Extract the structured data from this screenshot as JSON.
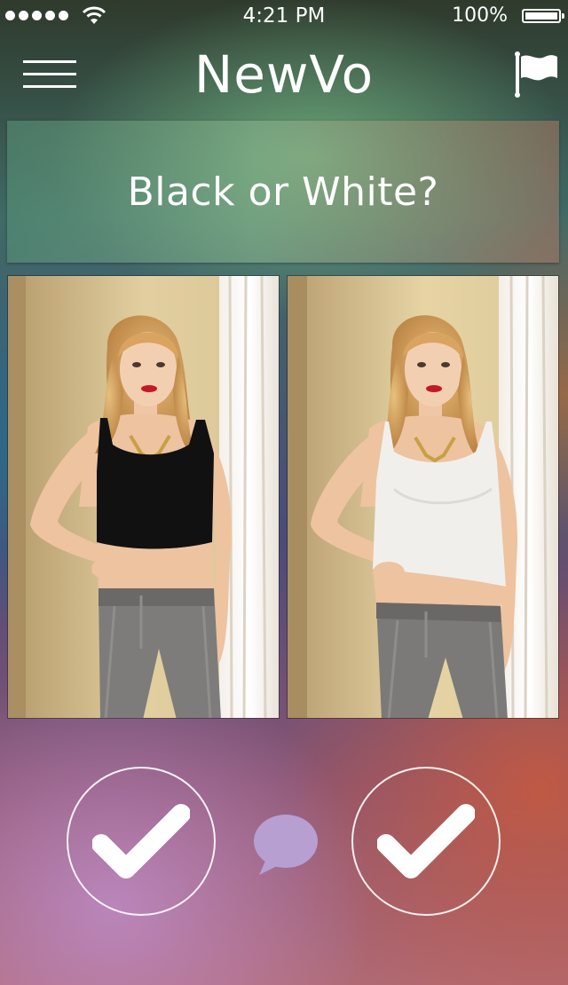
{
  "status_bar": {
    "signal_icon": "signal-dots-icon",
    "wifi_icon": "wifi-icon",
    "time": "4:21 PM",
    "battery_percent": "100%",
    "battery_icon": "battery-icon"
  },
  "navbar": {
    "title": "NewVo",
    "menu_icon": "hamburger-menu-icon",
    "flag_icon": "flag-icon"
  },
  "question": {
    "text": "Black or White?"
  },
  "options": [
    {
      "photo": "woman-black-crop-top-photo",
      "vote_icon": "checkmark-icon"
    },
    {
      "photo": "woman-white-crop-top-photo",
      "vote_icon": "checkmark-icon"
    }
  ],
  "comment_icon": "speech-bubble-icon",
  "colors": {
    "comment_bubble": "#b79fd2",
    "text": "#ffffff"
  }
}
